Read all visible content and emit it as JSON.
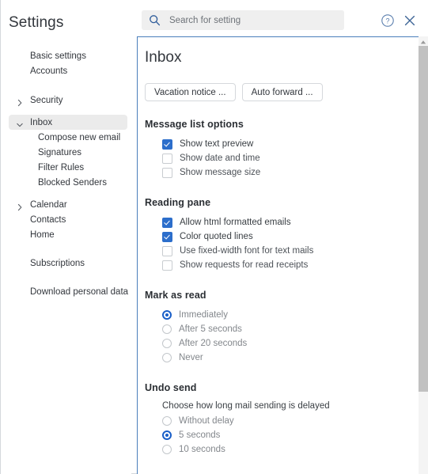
{
  "sidebar": {
    "title": "Settings",
    "items": [
      {
        "label": "Basic settings",
        "level": 1,
        "chevron": "none",
        "selected": false
      },
      {
        "label": "Accounts",
        "level": 1,
        "chevron": "none",
        "selected": false
      },
      {
        "label": "Security",
        "level": 1,
        "chevron": "chevron-right-icon",
        "selected": false
      },
      {
        "label": "Inbox",
        "level": 1,
        "chevron": "chevron-down-icon",
        "selected": true
      },
      {
        "label": "Compose new email",
        "level": 2,
        "chevron": "none",
        "selected": false
      },
      {
        "label": "Signatures",
        "level": 2,
        "chevron": "none",
        "selected": false
      },
      {
        "label": "Filter Rules",
        "level": 2,
        "chevron": "none",
        "selected": false
      },
      {
        "label": "Blocked Senders",
        "level": 2,
        "chevron": "none",
        "selected": false
      },
      {
        "label": "Calendar",
        "level": 1,
        "chevron": "chevron-right-icon",
        "selected": false
      },
      {
        "label": "Contacts",
        "level": 1,
        "chevron": "none",
        "selected": false
      },
      {
        "label": "Home",
        "level": 1,
        "chevron": "none",
        "selected": false
      },
      {
        "label": "Subscriptions",
        "level": 1,
        "chevron": "none",
        "selected": false
      },
      {
        "label": "Download personal data",
        "level": 1,
        "chevron": "none",
        "selected": false
      }
    ]
  },
  "topbar": {
    "search_placeholder": "Search for setting",
    "search_value": "",
    "help_icon": "help-circle-icon",
    "close_icon": "close-icon",
    "search_icon": "search-icon"
  },
  "content": {
    "title": "Inbox",
    "buttons": [
      {
        "label": "Vacation notice ..."
      },
      {
        "label": "Auto forward ..."
      }
    ],
    "sections": [
      {
        "heading": "Message list options",
        "type": "checkbox",
        "options": [
          {
            "label": "Show text preview",
            "checked": true
          },
          {
            "label": "Show date and time",
            "checked": false
          },
          {
            "label": "Show message size",
            "checked": false
          }
        ]
      },
      {
        "heading": "Reading pane",
        "type": "checkbox",
        "options": [
          {
            "label": "Allow html formatted emails",
            "checked": true
          },
          {
            "label": "Color quoted lines",
            "checked": true
          },
          {
            "label": "Use fixed-width font for text mails",
            "checked": false
          },
          {
            "label": "Show requests for read receipts",
            "checked": false
          }
        ]
      },
      {
        "heading": "Mark as read",
        "type": "radio",
        "options": [
          {
            "label": "Immediately",
            "selected": true
          },
          {
            "label": "After 5 seconds",
            "selected": false
          },
          {
            "label": "After 20 seconds",
            "selected": false
          },
          {
            "label": "Never",
            "selected": false
          }
        ]
      },
      {
        "heading": "Undo send",
        "type": "radio",
        "subtitle": "Choose how long mail sending is delayed",
        "options": [
          {
            "label": "Without delay",
            "selected": false
          },
          {
            "label": "5 seconds",
            "selected": true
          },
          {
            "label": "10 seconds",
            "selected": false
          }
        ]
      }
    ]
  },
  "scrollbar": {
    "up_arrow_icon": "scroll-up-arrow-icon"
  },
  "colors": {
    "accent_blue": "#2c6ecb",
    "panel_border_blue": "#4a7ebb",
    "selected_row_bg": "#ebebeb",
    "search_bg": "#efefef",
    "scroll_thumb": "#c1c1c1"
  }
}
